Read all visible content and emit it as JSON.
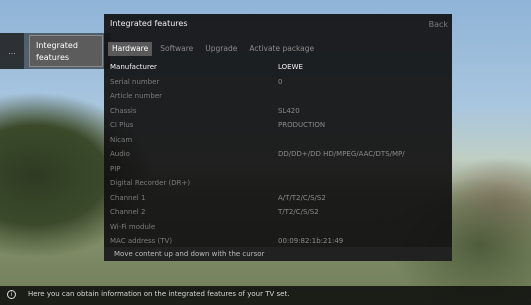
{
  "context_menu": {
    "left_item_label": "...",
    "active_item_label_line1": "Integrated",
    "active_item_label_line2": "features"
  },
  "panel": {
    "title": "Integrated features",
    "back_label": "Back",
    "tabs": [
      {
        "label": "Hardware",
        "active": true
      },
      {
        "label": "Software",
        "active": false
      },
      {
        "label": "Upgrade",
        "active": false
      },
      {
        "label": "Activate package",
        "active": false
      }
    ],
    "rows": [
      {
        "label": "Manufacturer",
        "value": "LOEWE"
      },
      {
        "label": "Serial number",
        "value": "0"
      },
      {
        "label": "Article number",
        "value": ""
      },
      {
        "label": "Chassis",
        "value": "SL420"
      },
      {
        "label": "CI Plus",
        "value": "PRODUCTION"
      },
      {
        "label": "Nicam",
        "value": ""
      },
      {
        "label": "Audio",
        "value": "DD/DD+/DD HD/MPEG/AAC/DTS/MP/"
      },
      {
        "label": "PIP",
        "value": ""
      },
      {
        "label": "Digital Recorder (DR+)",
        "value": ""
      },
      {
        "label": "Channel 1",
        "value": "A/T/T2/C/S/S2"
      },
      {
        "label": "Channel 2",
        "value": "T/T2/C/S/S2"
      },
      {
        "label": "Wi-Fi module",
        "value": ""
      },
      {
        "label": "MAC address (TV)",
        "value": "00:09:82:1b:21:49"
      }
    ],
    "hint": "Move content up and down with the cursor"
  },
  "info_bar": {
    "icon": "info-icon",
    "text": "Here you can obtain information on the integrated features of your TV set."
  }
}
